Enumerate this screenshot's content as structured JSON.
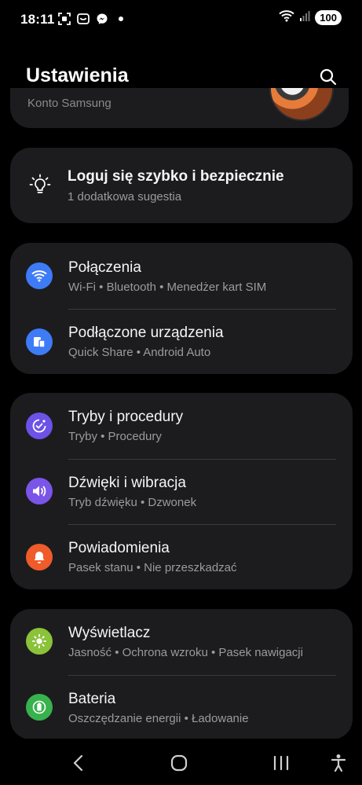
{
  "status_bar": {
    "time": "18:11",
    "battery": "100",
    "left_icons": [
      "screenshot-icon",
      "smile-app-icon",
      "messenger-icon",
      "notification-dot-icon"
    ],
    "right_icons": [
      "wifi-icon",
      "signal-icon"
    ]
  },
  "header": {
    "title": "Ustawienia",
    "search_icon": "search-icon"
  },
  "account": {
    "label": "Konto Samsung"
  },
  "suggestion": {
    "title": "Loguj się szybko i bezpiecznie",
    "subtitle": "1 dodatkowa sugestia",
    "icon": "lightbulb-icon"
  },
  "groups": [
    {
      "items": [
        {
          "title": "Połączenia",
          "subtitle": "Wi-Fi  •  Bluetooth  •  Menedżer kart SIM",
          "icon": "wifi-icon",
          "color": "#3e7bf7"
        },
        {
          "title": "Podłączone urządzenia",
          "subtitle": "Quick Share  •  Android Auto",
          "icon": "devices-icon",
          "color": "#3e7bf7"
        }
      ]
    },
    {
      "items": [
        {
          "title": "Tryby i procedury",
          "subtitle": "Tryby  •  Procedury",
          "icon": "modes-check-icon",
          "color": "#6c52e6"
        },
        {
          "title": "Dźwięki i wibracja",
          "subtitle": "Tryb dźwięku  •  Dzwonek",
          "icon": "speaker-icon",
          "color": "#7b54e8"
        },
        {
          "title": "Powiadomienia",
          "subtitle": "Pasek stanu  •  Nie przeszkadzać",
          "icon": "bell-icon",
          "color": "#ef5b2b"
        }
      ]
    },
    {
      "items": [
        {
          "title": "Wyświetlacz",
          "subtitle": "Jasność  •  Ochrona wzroku  •  Pasek nawigacji",
          "icon": "sun-icon",
          "color": "#8ac23a"
        },
        {
          "title": "Bateria",
          "subtitle": "Oszczędzanie energii  •  Ładowanie",
          "icon": "battery-icon",
          "color": "#37b24d"
        }
      ]
    }
  ],
  "nav_bar": {
    "back": "back-icon",
    "home": "home-icon",
    "recents": "recents-icon",
    "accessibility": "accessibility-icon"
  }
}
